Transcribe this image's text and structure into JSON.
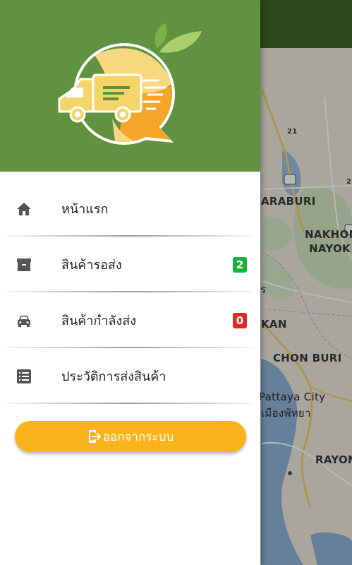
{
  "map": {
    "labels": {
      "saraburi": "ARABURI",
      "nakhon": "NAKHON",
      "nayok": "NAYOK",
      "r": "ร",
      "kan": "KAN",
      "chonburi": "CHON BURI",
      "pattaya_en": "Pattaya City",
      "pattaya_th": "เมืองพัทยา",
      "rayong": "RAYON",
      "route": "21",
      "route2": "2"
    }
  },
  "drawer": {
    "menu": [
      {
        "id": "home",
        "label": "หน้าแรก",
        "icon": "home-icon"
      },
      {
        "id": "pending",
        "label": "สินค้ารอส่ง",
        "icon": "archive-box-icon",
        "badge": "2",
        "badge_color": "#17b334"
      },
      {
        "id": "shipping",
        "label": "สินค้ากำลังส่ง",
        "icon": "car-icon",
        "badge": "0",
        "badge_color": "#e02b22"
      },
      {
        "id": "history",
        "label": "ประวัติการส่งสินค้า",
        "icon": "list-icon"
      }
    ],
    "logout_label": "ออกจากระบบ",
    "logout_icon": "logout-icon"
  },
  "colors": {
    "header": "#61923f",
    "app_bar": "#3f6626",
    "accent": "#fab31b"
  }
}
